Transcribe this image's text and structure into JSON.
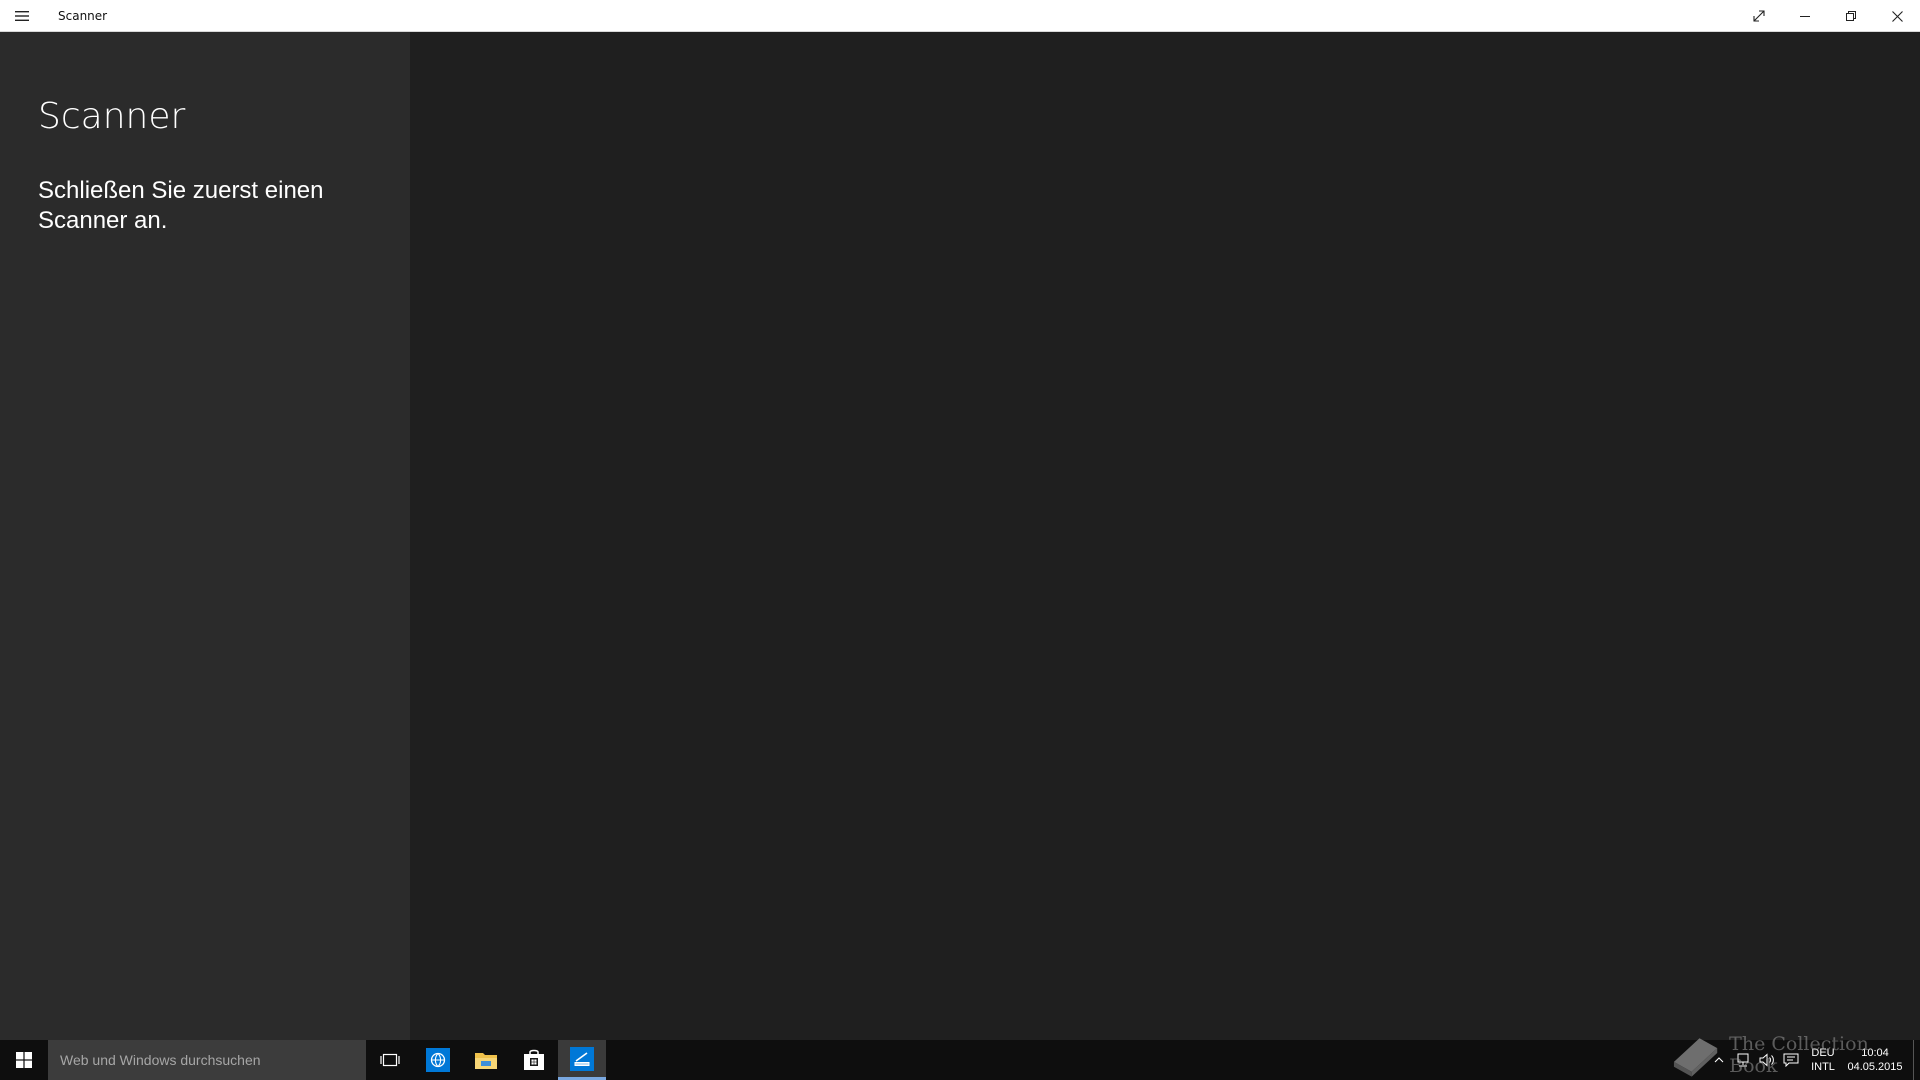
{
  "window": {
    "title": "Scanner"
  },
  "left_pane": {
    "heading": "Scanner",
    "message": "Schließen Sie zuerst einen Scanner an."
  },
  "taskbar": {
    "search_placeholder": "Web und Windows durchsuchen",
    "apps": [
      {
        "name": "task-view-icon"
      },
      {
        "name": "edge-browser-icon"
      },
      {
        "name": "file-explorer-icon"
      },
      {
        "name": "store-icon"
      },
      {
        "name": "scanner-app-icon",
        "active": true
      }
    ],
    "tray": {
      "language_line1": "DEU",
      "language_line2": "INTL",
      "time": "10:04",
      "date": "04.05.2015"
    }
  },
  "watermark": {
    "text": "The Collection Book"
  },
  "colors": {
    "accent": "#0078d7",
    "pane_bg": "#2b2b2b",
    "main_bg": "#1f1f1f",
    "taskbar_bg": "#0e0e0e"
  }
}
